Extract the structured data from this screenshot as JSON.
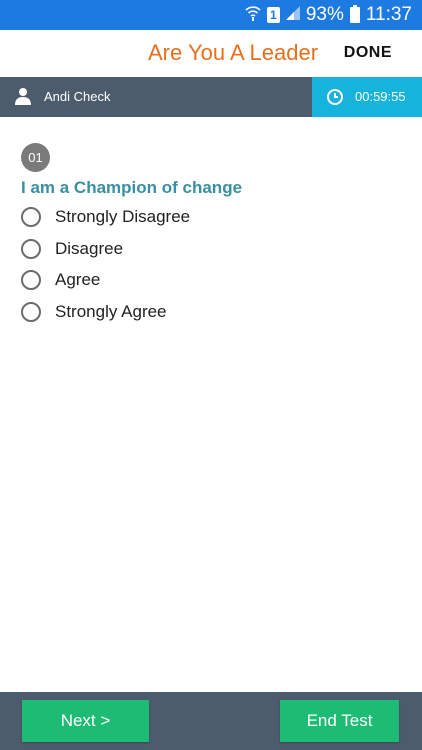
{
  "status_bar": {
    "battery": "93%",
    "time": "11:37",
    "sim": "1"
  },
  "header": {
    "title": "Are You A Leader",
    "done_label": "DONE"
  },
  "user_bar": {
    "name": "Andi Check",
    "timer": "00:59:55"
  },
  "question": {
    "number": "01",
    "text": "I am a Champion of change",
    "options": [
      {
        "label": "Strongly Disagree"
      },
      {
        "label": "Disagree"
      },
      {
        "label": "Agree"
      },
      {
        "label": "Strongly Agree"
      }
    ]
  },
  "footer": {
    "next_label": "Next >",
    "end_label": "End Test"
  },
  "colors": {
    "status_bar": "#1d7ae0",
    "title": "#e8701c",
    "user_bar": "#4c5c6c",
    "timer_bg": "#16b3dc",
    "question_text": "#3b8fa3",
    "button": "#1dbb74"
  }
}
